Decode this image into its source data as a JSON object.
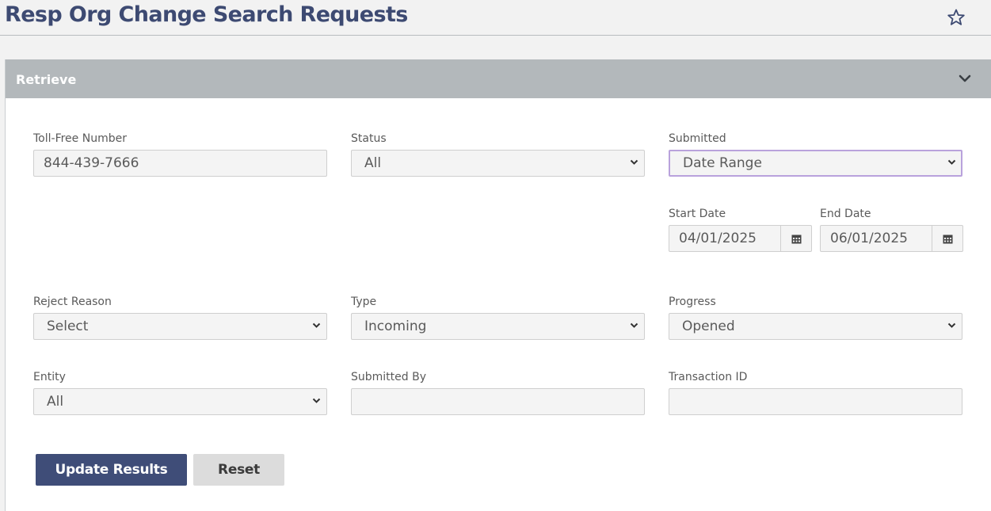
{
  "page": {
    "title": "Resp Org Change Search Requests",
    "favorite_icon": "star-icon"
  },
  "panel": {
    "title": "Retrieve",
    "toggle_icon": "chevron-down-icon"
  },
  "form": {
    "toll_free_number": {
      "label": "Toll-Free Number",
      "value": "844-439-7666",
      "placeholder": ""
    },
    "status": {
      "label": "Status",
      "selected": "All"
    },
    "submitted": {
      "label": "Submitted",
      "selected": "Date Range"
    },
    "start_date": {
      "label": "Start Date",
      "value": "04/01/2025",
      "icon": "calendar-icon"
    },
    "end_date": {
      "label": "End Date",
      "value": "06/01/2025",
      "icon": "calendar-icon"
    },
    "reject_reason": {
      "label": "Reject Reason",
      "selected": "Select"
    },
    "type": {
      "label": "Type",
      "selected": "Incoming"
    },
    "progress": {
      "label": "Progress",
      "selected": "Opened"
    },
    "entity": {
      "label": "Entity",
      "selected": "All"
    },
    "submitted_by": {
      "label": "Submitted By",
      "value": ""
    },
    "transaction_id": {
      "label": "Transaction ID",
      "value": ""
    }
  },
  "actions": {
    "update_label": "Update Results",
    "reset_label": "Reset"
  },
  "colors": {
    "title": "#3d4a72",
    "primary_button": "#3f4d78",
    "panel_header": "#b3b8bb",
    "focus_border": "#b9a2dc"
  }
}
